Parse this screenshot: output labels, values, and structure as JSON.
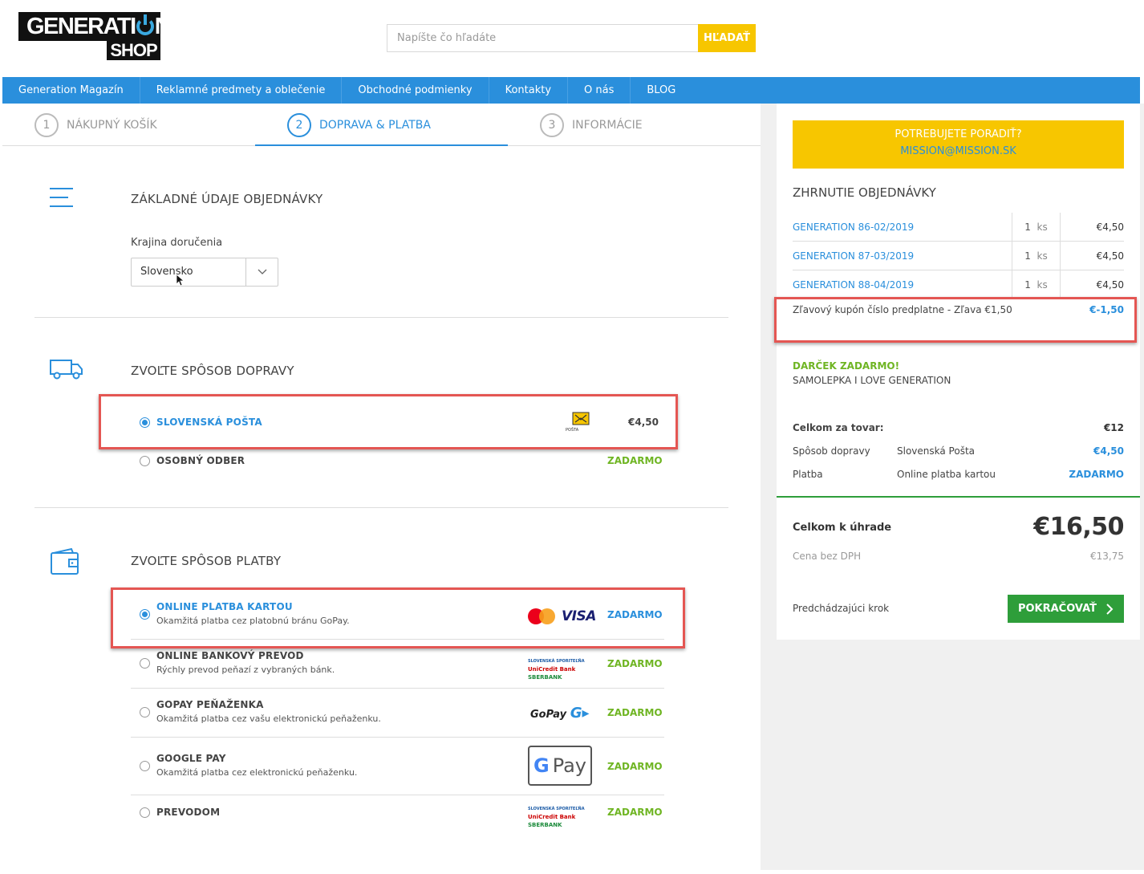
{
  "logo": {
    "line1_a": "GENERATI",
    "line1_b": "N",
    "line2": "SHOP"
  },
  "search": {
    "placeholder": "Napíšte čo hľadáte",
    "button_label": "HĽADAŤ"
  },
  "nav": [
    "Generation Magazín",
    "Reklamné predmety a oblečenie",
    "Obchodné podmienky",
    "Kontakty",
    "O nás",
    "BLOG"
  ],
  "steps": [
    {
      "num": "1",
      "label": "NÁKUPNÝ KOŠÍK"
    },
    {
      "num": "2",
      "label": "DOPRAVA & PLATBA"
    },
    {
      "num": "3",
      "label": "INFORMÁCIE"
    }
  ],
  "basic": {
    "title": "ZÁKLADNÉ ÚDAJE OBJEDNÁVKY",
    "country_label": "Krajina doručenia",
    "country_value": "Slovensko"
  },
  "shipping": {
    "title": "ZVOĽTE SPÔSOB DOPRAVY",
    "options": [
      {
        "name": "SLOVENSKÁ POŠTA",
        "price": "€4,50",
        "logo_text": "Slovenská POŠTA"
      },
      {
        "name": "OSOBNÝ ODBER",
        "price": "ZADARMO"
      }
    ]
  },
  "payment": {
    "title": "ZVOĽTE SPÔSOB PLATBY",
    "options": [
      {
        "name": "ONLINE PLATBA KARTOU",
        "desc": "Okamžitá platba cez platobnú bránu GoPay.",
        "price": "ZADARMO"
      },
      {
        "name": "ONLINE BANKOVÝ PREVOD",
        "desc": "Rýchly prevod peňazí z vybraných bánk.",
        "price": "ZADARMO"
      },
      {
        "name": "GOPAY PEŇAŽENKA",
        "desc": "Okamžitá platba cez vašu elektronickú peňaženku.",
        "price": "ZADARMO"
      },
      {
        "name": "GOOGLE PAY",
        "desc": "Okamžitá platba cez elektronickú peňaženku.",
        "price": "ZADARMO"
      },
      {
        "name": "PREVODOM",
        "price": "ZADARMO"
      }
    ],
    "visa_text": "VISA",
    "gopay_text": "GoPay",
    "gpay_text": "Pay",
    "bank_text": {
      "a": "SLOVENSKÁ SPORITEĽŇA",
      "b": "UniCredit Bank",
      "c": "SBERBANK"
    }
  },
  "sidebar": {
    "advice_title": "POTREBUJETE PORADIŤ?",
    "advice_email": "MISSION@MISSION.SK",
    "summary_title": "ZHRNUTIE OBJEDNÁVKY",
    "items": [
      {
        "name": "GENERATION 86-02/2019",
        "qty": "1",
        "unit": "ks",
        "price": "€4,50"
      },
      {
        "name": "GENERATION 87-03/2019",
        "qty": "1",
        "unit": "ks",
        "price": "€4,50"
      },
      {
        "name": "GENERATION 88-04/2019",
        "qty": "1",
        "unit": "ks",
        "price": "€4,50"
      }
    ],
    "coupon_label": "Zľavový kupón číslo predplatne - Zľava €1,50",
    "coupon_value": "€-1,50",
    "gift_title": "DARČEK ZADARMO!",
    "gift_item": "SAMOLEPKA I LOVE GENERATION",
    "goods_label": "Celkom za tovar:",
    "goods_value": "€12",
    "shipping_label": "Spôsob dopravy",
    "shipping_method": "Slovenská Pošta",
    "shipping_value": "€4,50",
    "payment_label": "Platba",
    "payment_method": "Online platba kartou",
    "payment_value": "ZADARMO",
    "total_label": "Celkom k úhrade",
    "total_value": "€16,50",
    "novat_label": "Cena bez DPH",
    "novat_value": "€13,75",
    "prev_label": "Predchádzajúci krok",
    "next_label": "POKRAČOVAŤ"
  },
  "colors": {
    "accent": "#2a8fdc",
    "cta": "#2e9e3a",
    "yellow": "#f7c600",
    "free": "#6fb523",
    "highlight": "#e45653"
  }
}
